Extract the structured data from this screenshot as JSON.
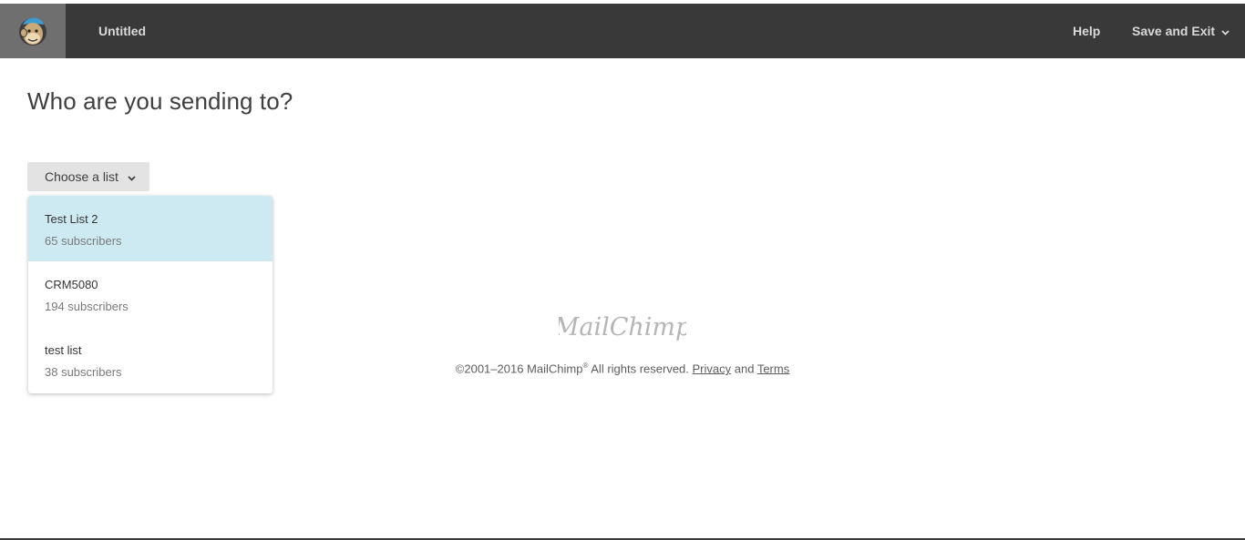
{
  "header": {
    "title": "Untitled",
    "help_label": "Help",
    "save_exit_label": "Save and Exit",
    "logo_icon": "mailchimp-freddie-icon"
  },
  "main": {
    "heading": "Who are you sending to?",
    "choose_list_label": "Choose a list",
    "lists": [
      {
        "name": "Test List 2",
        "subscribers": "65 subscribers"
      },
      {
        "name": "CRM5080",
        "subscribers": "194 subscribers"
      },
      {
        "name": "test list",
        "subscribers": "38 subscribers"
      }
    ]
  },
  "footer": {
    "wordmark": "MailChimp",
    "copyright_prefix": "©2001–2016 MailChimp",
    "registered": "®",
    "rights": " All rights reserved. ",
    "privacy_label": "Privacy",
    "and_text": " and ",
    "terms_label": "Terms"
  },
  "colors": {
    "topbar": "#393939",
    "logo_box": "#6f6f6f",
    "active_item": "#cdeaf2",
    "button": "#e3e3e3"
  }
}
